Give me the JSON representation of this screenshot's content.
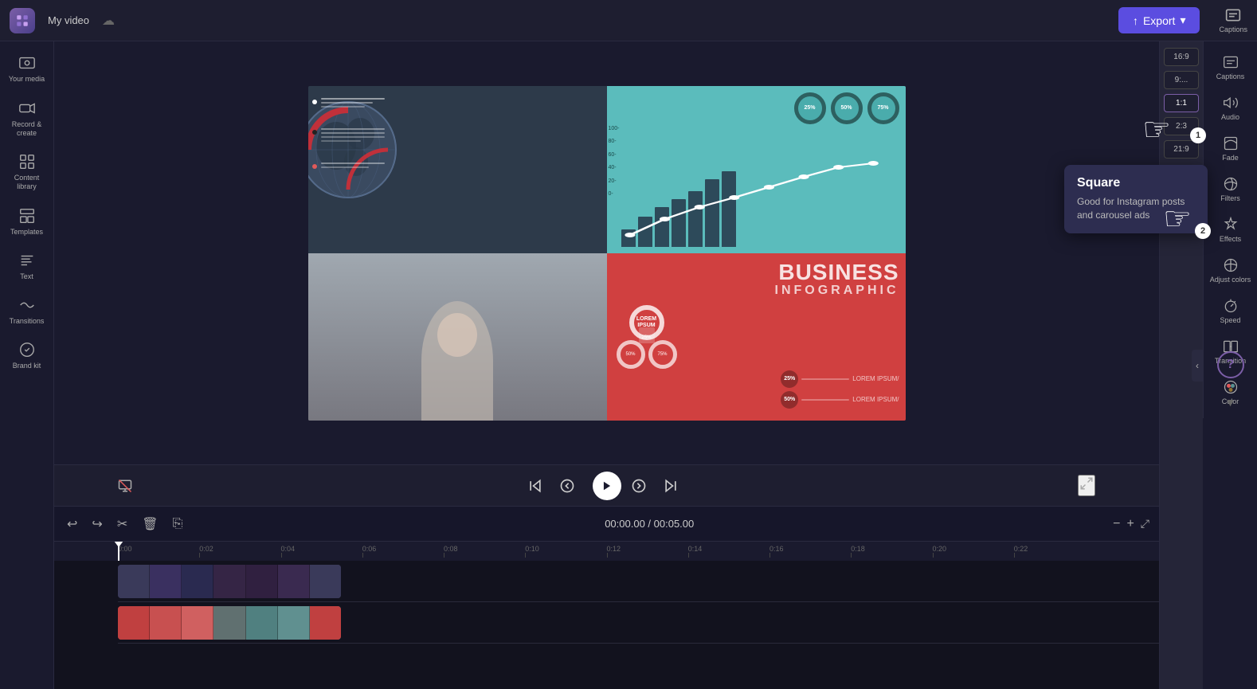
{
  "app": {
    "logo": "✦",
    "project_name": "My video",
    "export_label": "Export"
  },
  "left_sidebar": {
    "items": [
      {
        "id": "your-media",
        "label": "Your media",
        "icon": "media"
      },
      {
        "id": "record-create",
        "label": "Record &\ncreate",
        "icon": "record"
      },
      {
        "id": "content-library",
        "label": "Content library",
        "icon": "library"
      },
      {
        "id": "templates",
        "label": "Templates",
        "icon": "templates"
      },
      {
        "id": "text",
        "label": "Text",
        "icon": "text"
      },
      {
        "id": "transitions",
        "label": "Transitions",
        "icon": "transitions"
      },
      {
        "id": "brand-kit",
        "label": "Brand kit",
        "icon": "brand"
      }
    ]
  },
  "aspect_ratios": [
    {
      "label": "16:9",
      "value": "16:9",
      "active": false
    },
    {
      "label": "9:...",
      "value": "9:16",
      "active": false
    },
    {
      "label": "1:1",
      "value": "1:1",
      "active": true
    },
    {
      "label": "2:3",
      "value": "2:3",
      "active": false
    },
    {
      "label": "21:9",
      "value": "21:9",
      "active": false
    }
  ],
  "square_tooltip": {
    "title": "Square",
    "description": "Good for Instagram posts and carousel ads"
  },
  "tool_sidebar": {
    "items": [
      {
        "id": "captions",
        "label": "Captions",
        "icon": "captions"
      },
      {
        "id": "audio",
        "label": "Audio",
        "icon": "audio"
      },
      {
        "id": "fade",
        "label": "Fade",
        "icon": "fade"
      },
      {
        "id": "filters",
        "label": "Filters",
        "icon": "filters"
      },
      {
        "id": "effects",
        "label": "Effects",
        "icon": "effects"
      },
      {
        "id": "adjust-colors",
        "label": "Adjust colors",
        "icon": "adjust"
      },
      {
        "id": "speed",
        "label": "Speed",
        "icon": "speed"
      },
      {
        "id": "transition",
        "label": "Transition",
        "icon": "transition"
      },
      {
        "id": "color",
        "label": "Color",
        "icon": "color"
      }
    ],
    "help_label": "?",
    "collapse_label": "▼"
  },
  "playback": {
    "current_time": "00:00.00",
    "total_time": "00:05.00",
    "separator": "/"
  },
  "timeline": {
    "undo_label": "↩",
    "redo_label": "↪",
    "cut_label": "✂",
    "delete_label": "🗑",
    "copy_label": "⎘",
    "time_display": "00:00.00 / 00:05.00",
    "ruler_marks": [
      "0:00",
      "0:02",
      "0:04",
      "0:06",
      "0:08",
      "0:10",
      "0:12",
      "0:14",
      "0:16",
      "0:18",
      "0:20",
      "0:22"
    ]
  },
  "chart_bars": [
    20,
    35,
    45,
    55,
    65,
    80,
    90
  ],
  "donut_values": [
    "25%",
    "50%",
    "75%"
  ],
  "lorem_items": [
    {
      "color": "#fff",
      "lines": [
        80,
        60
      ]
    },
    {
      "color": "#222",
      "lines": [
        80,
        80,
        50
      ]
    },
    {
      "color": "#e05a5a",
      "lines": [
        80,
        60
      ]
    }
  ]
}
